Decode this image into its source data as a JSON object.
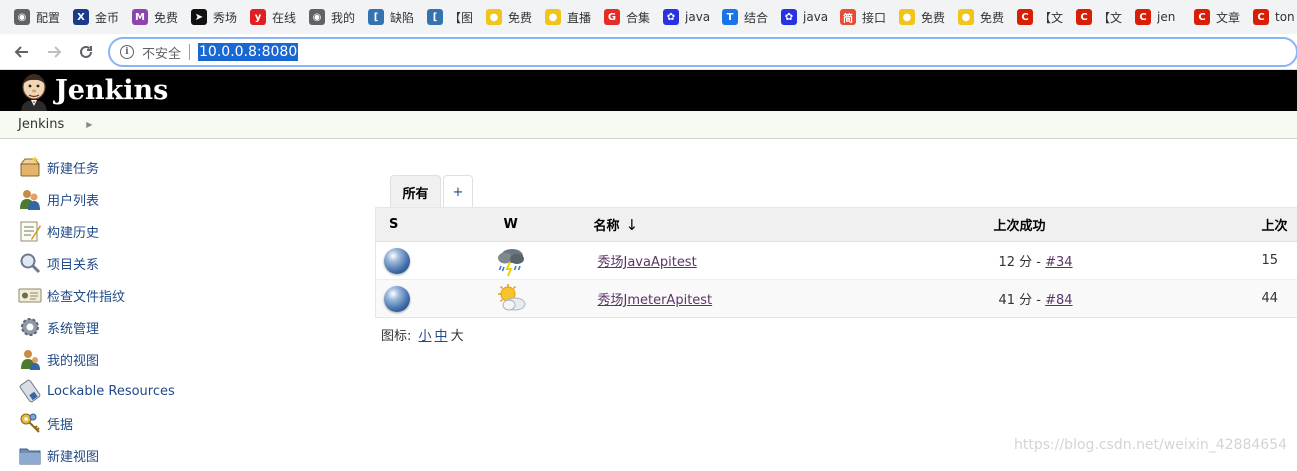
{
  "browser": {
    "bookmarks": [
      {
        "label": "配置",
        "icon": "globe-icon",
        "color": "#5f6368"
      },
      {
        "label": "金币",
        "icon": "x-logo-icon",
        "color": "#1a3a8c"
      },
      {
        "label": "免费",
        "icon": "m-logo-icon",
        "color": "#8e44ad"
      },
      {
        "label": "秀场",
        "icon": "compass-icon",
        "color": "#111111"
      },
      {
        "label": "在线",
        "icon": "y-logo-icon",
        "color": "#e02020"
      },
      {
        "label": "我的",
        "icon": "globe-icon",
        "color": "#5f6368"
      },
      {
        "label": "缺陷",
        "icon": "bracket-icon",
        "color": "#3572b0"
      },
      {
        "label": "【图",
        "icon": "bracket-icon",
        "color": "#3572b0"
      },
      {
        "label": "免费",
        "icon": "cat-icon",
        "color": "#f0c419"
      },
      {
        "label": "直播",
        "icon": "cat-icon",
        "color": "#f0c419"
      },
      {
        "label": "合集",
        "icon": "g-logo-icon",
        "color": "#e52d27"
      },
      {
        "label": "java",
        "icon": "paw-icon",
        "color": "#2932e1"
      },
      {
        "label": "结合",
        "icon": "shield-icon",
        "color": "#1a73e8"
      },
      {
        "label": "java",
        "icon": "paw-icon",
        "color": "#2932e1"
      },
      {
        "label": "接口",
        "icon": "jian-icon",
        "color": "#e94b35"
      },
      {
        "label": "免费",
        "icon": "cat-icon",
        "color": "#f0c419"
      },
      {
        "label": "免费",
        "icon": "cat-icon",
        "color": "#f0c419"
      },
      {
        "label": "【文",
        "icon": "csdn-icon",
        "color": "#d81e06"
      },
      {
        "label": "【文",
        "icon": "csdn-icon",
        "color": "#d81e06"
      },
      {
        "label": "jen",
        "icon": "csdn-icon",
        "color": "#d81e06"
      },
      {
        "label": "文章",
        "icon": "csdn-icon",
        "color": "#d81e06"
      },
      {
        "label": "ton",
        "icon": "csdn-icon",
        "color": "#d81e06"
      }
    ],
    "insecure_label": "不安全",
    "url": "10.0.0.8:8080"
  },
  "header": {
    "title": "Jenkins"
  },
  "breadcrumb": {
    "root": "Jenkins"
  },
  "tasks": [
    {
      "label": "新建任务",
      "icon": "new-item-icon"
    },
    {
      "label": "用户列表",
      "icon": "people-icon"
    },
    {
      "label": "构建历史",
      "icon": "build-history-icon"
    },
    {
      "label": "项目关系",
      "icon": "search-icon"
    },
    {
      "label": "检查文件指纹",
      "icon": "fingerprint-icon"
    },
    {
      "label": "系统管理",
      "icon": "gear-icon"
    },
    {
      "label": "我的视图",
      "icon": "user-icon"
    },
    {
      "label": "Lockable Resources",
      "icon": "usb-icon"
    },
    {
      "label": "凭据",
      "icon": "keys-icon"
    },
    {
      "label": "新建视图",
      "icon": "folder-icon"
    }
  ],
  "tabs": {
    "all": "所有",
    "add": "+"
  },
  "table": {
    "headers": {
      "s": "S",
      "w": "W",
      "name": "名称",
      "name_sort": "↓",
      "last_success": "上次成功",
      "last_failure": "上次"
    },
    "rows": [
      {
        "status": "blue-ball-icon",
        "weather": "storm-icon",
        "name": "秀场JavaApitest",
        "last_success_time": "12 分 - ",
        "last_success_build": "#34",
        "last_failure": "15"
      },
      {
        "status": "blue-ball-icon",
        "weather": "partly-cloudy-icon",
        "name": "秀场JmeterApitest",
        "last_success_time": "41 分 - ",
        "last_success_build": "#84",
        "last_failure": "44"
      }
    ]
  },
  "legend": {
    "label": "图标:",
    "small": "小",
    "medium": "中",
    "large": "大"
  },
  "watermark": "https://blog.csdn.net/weixin_42884654"
}
